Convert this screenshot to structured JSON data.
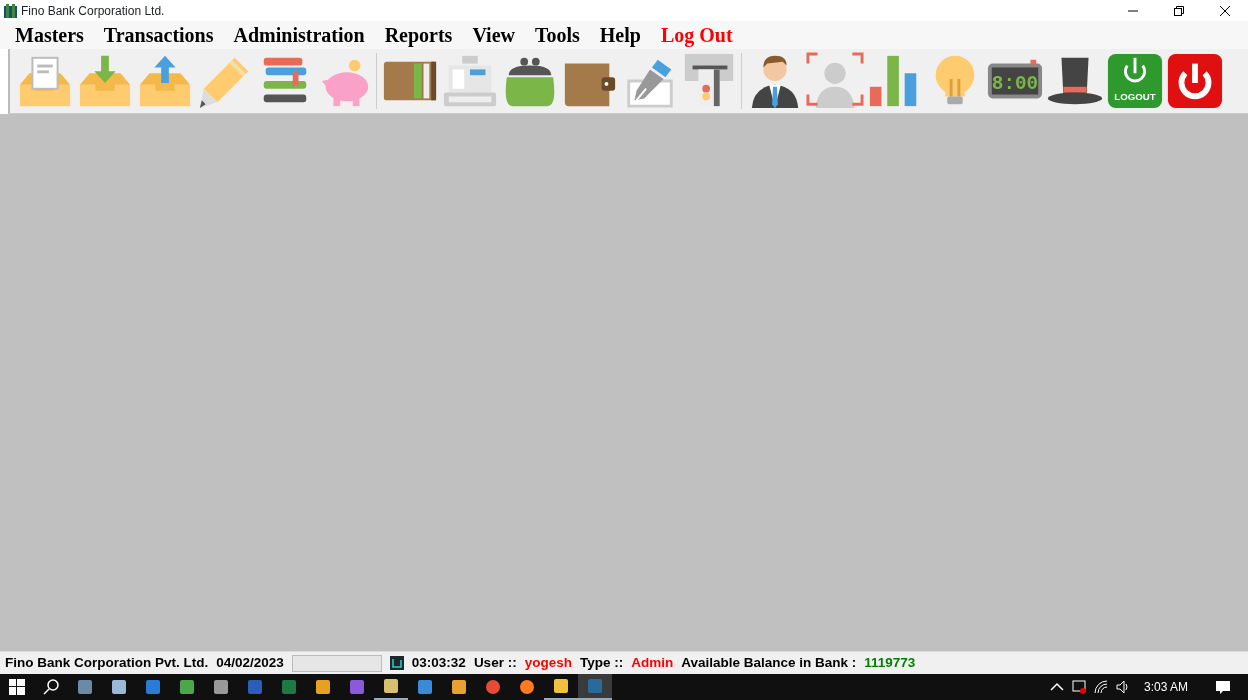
{
  "window": {
    "title": "Fino Bank Corporation Ltd."
  },
  "menu": [
    {
      "label": "Masters",
      "color": "#000000"
    },
    {
      "label": "Transactions",
      "color": "#000000"
    },
    {
      "label": "Administration",
      "color": "#000000"
    },
    {
      "label": "Reports",
      "color": "#000000"
    },
    {
      "label": "View",
      "color": "#000000"
    },
    {
      "label": "Tools",
      "color": "#000000"
    },
    {
      "label": "Help",
      "color": "#000000"
    },
    {
      "label": "Log Out",
      "color": "#ff0000"
    }
  ],
  "toolbar": {
    "clock_display": "8:00",
    "logout_label": "LOGOUT"
  },
  "status_bar": [
    {
      "kind": "text",
      "text": "Fino Bank Corporation Pvt. Ltd.",
      "color": "#000000"
    },
    {
      "kind": "text",
      "text": "04/02/2023",
      "color": "#000000"
    },
    {
      "kind": "field"
    },
    {
      "kind": "clock",
      "text": "03:03:32",
      "color": "#000000"
    },
    {
      "kind": "text",
      "text": "User ::",
      "color": "#000000"
    },
    {
      "kind": "text",
      "text": "yogesh",
      "color": "#ff0000"
    },
    {
      "kind": "text",
      "text": "Type ::",
      "color": "#000000"
    },
    {
      "kind": "text",
      "text": "Admin",
      "color": "#ff0000"
    },
    {
      "kind": "text",
      "text": "Available Balance in Bank :",
      "color": "#000000"
    },
    {
      "kind": "text",
      "text": "1119773",
      "color": "#008000"
    }
  ],
  "taskbar": {
    "apps": [
      {
        "selected": false,
        "running": false
      },
      {
        "selected": false,
        "running": false
      },
      {
        "selected": false,
        "running": false
      },
      {
        "selected": false,
        "running": false
      },
      {
        "selected": false,
        "running": false
      },
      {
        "selected": false,
        "running": false
      },
      {
        "selected": false,
        "running": false
      },
      {
        "selected": false,
        "running": false
      },
      {
        "selected": false,
        "running": false
      },
      {
        "selected": false,
        "running": true
      },
      {
        "selected": false,
        "running": false
      },
      {
        "selected": false,
        "running": false
      },
      {
        "selected": false,
        "running": false
      },
      {
        "selected": false,
        "running": false
      },
      {
        "selected": false,
        "running": true
      },
      {
        "selected": true,
        "running": true
      }
    ],
    "time": "3:03 AM"
  }
}
